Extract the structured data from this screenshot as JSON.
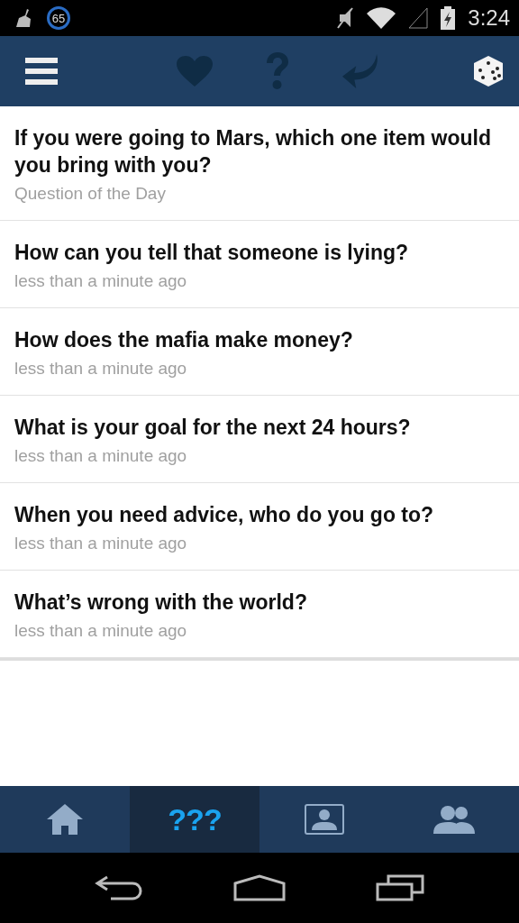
{
  "status_bar": {
    "badge": "65",
    "time": "3:24"
  },
  "toolbar": {
    "items": [
      {
        "kind": "menu"
      },
      {
        "kind": "heart"
      },
      {
        "kind": "question"
      },
      {
        "kind": "reply"
      },
      {
        "kind": "dice"
      }
    ]
  },
  "questions": [
    {
      "title": "If you were going to Mars, which one item would you bring with you?",
      "subtitle": "Question of the Day"
    },
    {
      "title": "How can you tell that someone is lying?",
      "subtitle": "less than a minute ago"
    },
    {
      "title": "How does the mafia make money?",
      "subtitle": "less than a minute ago"
    },
    {
      "title": "What is your goal for the next 24 hours?",
      "subtitle": "less than a minute ago"
    },
    {
      "title": "When you need advice, who do you go to?",
      "subtitle": "less than a minute ago"
    },
    {
      "title": "What’s wrong with the world?",
      "subtitle": "less than a minute ago"
    }
  ],
  "tabs": [
    {
      "kind": "home",
      "selected": false
    },
    {
      "kind": "questions",
      "label": "???",
      "selected": true
    },
    {
      "kind": "profile",
      "selected": false
    },
    {
      "kind": "friends",
      "selected": false
    }
  ],
  "nav_bar": {
    "items": [
      {
        "kind": "back"
      },
      {
        "kind": "home"
      },
      {
        "kind": "recents"
      }
    ]
  }
}
